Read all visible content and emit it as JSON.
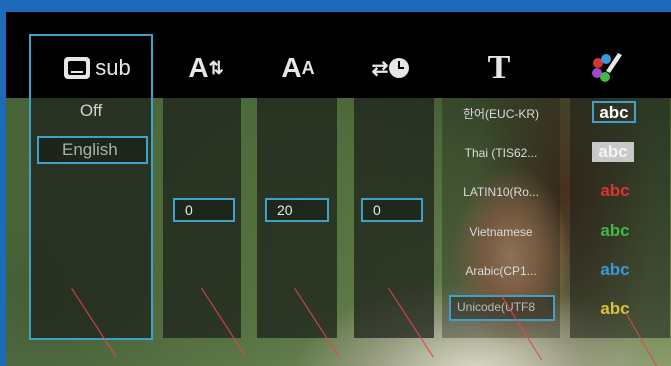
{
  "toolbar": {
    "sub_label": "sub",
    "icons": [
      "subtitle-display-icon",
      "font-size-icon",
      "text-position-icon",
      "sync-time-icon",
      "font-style-icon",
      "color-palette-icon"
    ]
  },
  "subtitle_options": {
    "off": "Off",
    "selected": "English"
  },
  "values": {
    "size": "0",
    "font_size": "20",
    "sync": "0"
  },
  "encodings": [
    "한어(EUC-KR)",
    "Thai (TIS62...",
    "LATIN10(Ro...",
    "Vietnamese",
    "Arabic(CP1...",
    "Unicode(UTF8"
  ],
  "color_samples": [
    {
      "label": "abc",
      "color": "#ffffff"
    },
    {
      "label": "abc",
      "color": "#ffffff"
    },
    {
      "label": "abc",
      "color": "#d93434"
    },
    {
      "label": "abc",
      "color": "#3fb848"
    },
    {
      "label": "abc",
      "color": "#3a9ad8"
    },
    {
      "label": "abc",
      "color": "#d8c23a"
    }
  ],
  "accent": "#3fa0c8"
}
